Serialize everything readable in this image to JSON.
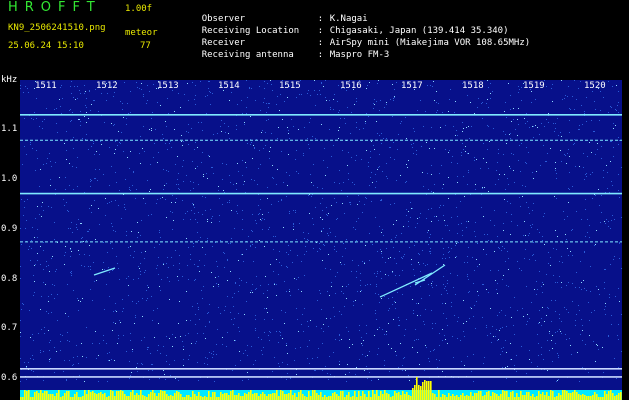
{
  "header": {
    "app_title": "HROFFT",
    "version": "1.00f",
    "filename": "KN9_2506241510.png",
    "datetime": "25.06.24 15:10",
    "meteor_label": "meteor",
    "meteor_count": "77"
  },
  "info": [
    {
      "key": "Observer",
      "value": "K.Nagai"
    },
    {
      "key": "Receiving Location",
      "value": "Chigasaki, Japan (139.414 35.340)"
    },
    {
      "key": "Receiver",
      "value": "AirSpy mini (Miakejima VOR 108.65MHz)"
    },
    {
      "key": "Receiving antenna",
      "value": "Maspro FM-3"
    }
  ],
  "spectrogram": {
    "y_unit": "kHz",
    "y_ticks": [
      "1.1",
      "1.0",
      "0.9",
      "0.8",
      "0.7",
      "0.6"
    ],
    "x_ticks": [
      "1511",
      "1512",
      "1513",
      "1514",
      "1515",
      "1516",
      "1517",
      "1518",
      "1519",
      "1520"
    ],
    "y_range_khz": [
      0.6,
      1.15
    ],
    "signal_lines_khz": [
      1.12,
      1.07,
      0.965,
      0.87,
      0.62,
      0.604
    ],
    "colors": {
      "background": "#07108a",
      "signal": "#7fe9ff",
      "noise_bar": "#ffff00",
      "text": "#ffffff",
      "title": "#33e833",
      "accent": "#e8e800"
    }
  }
}
